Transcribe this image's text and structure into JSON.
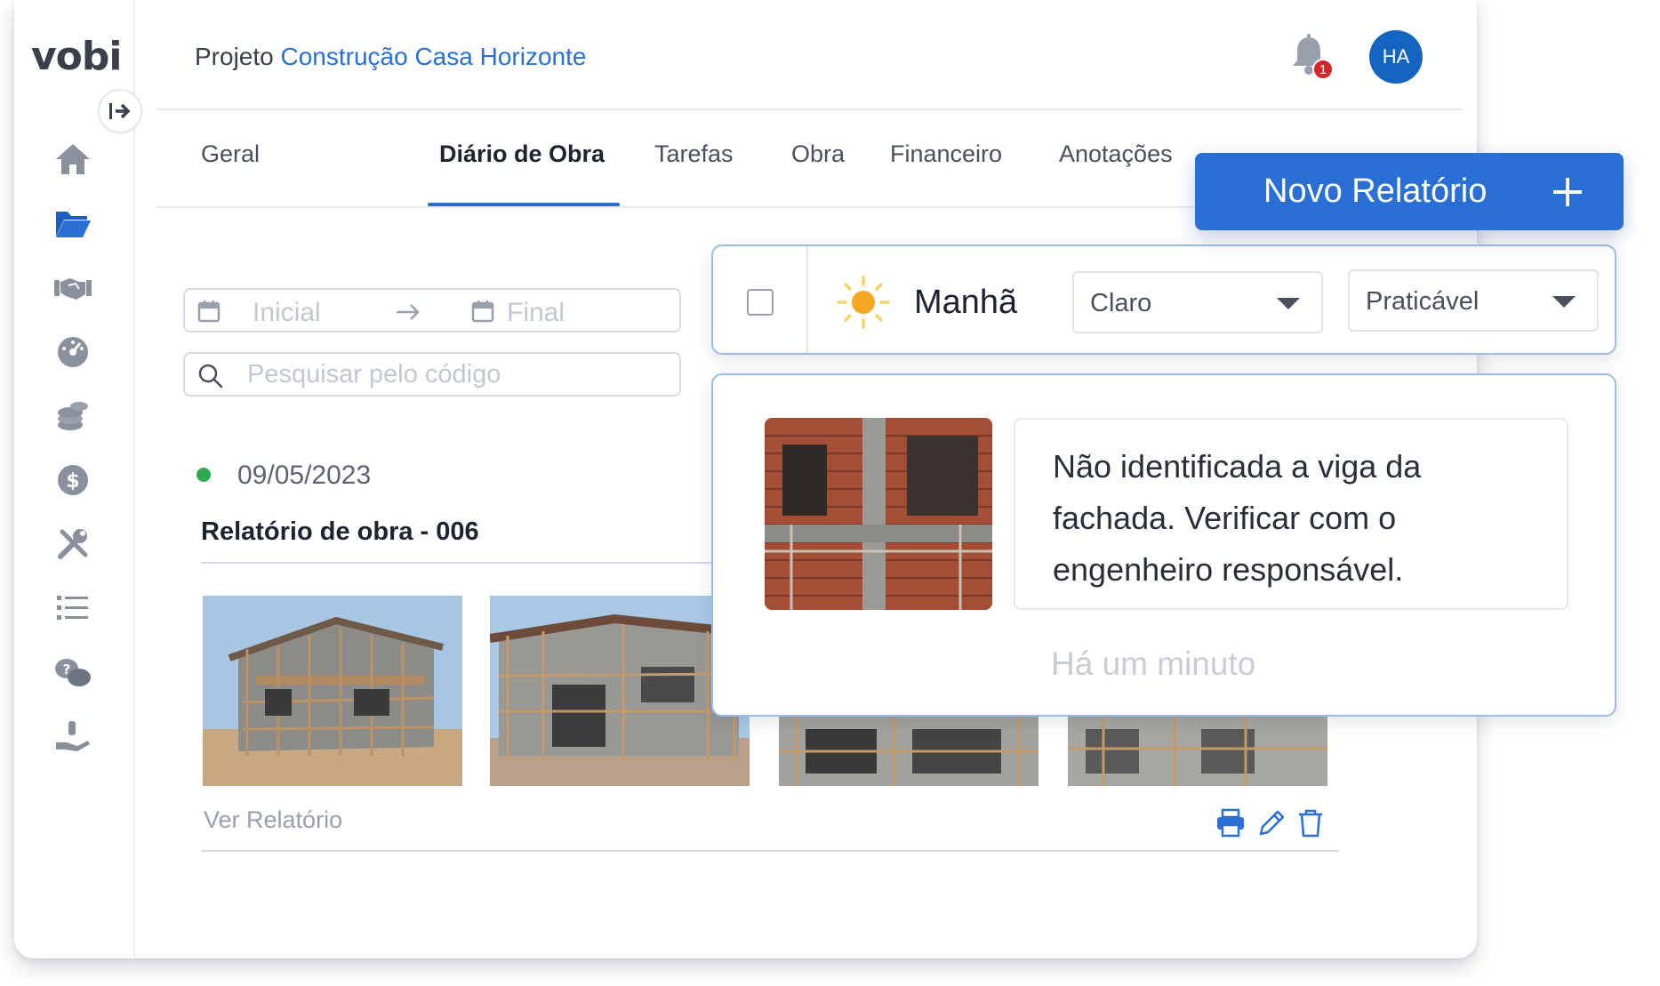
{
  "app": {
    "logo": "vobi"
  },
  "header": {
    "project_prefix": "Projeto",
    "project_name": "Construção Casa Horizonte",
    "notification_count": "1",
    "avatar_initials": "HA"
  },
  "tabs": [
    {
      "label": "Geral"
    },
    {
      "label": "Diário de Obra",
      "active": true
    },
    {
      "label": "Tarefas"
    },
    {
      "label": "Obra"
    },
    {
      "label": "Financeiro"
    },
    {
      "label": "Anotações"
    }
  ],
  "sidebar": {
    "icons": [
      "home-icon",
      "folder-icon",
      "handshake-icon",
      "dashboard-icon",
      "coins-icon",
      "dollar-icon",
      "tools-icon",
      "list-icon",
      "chat-help-icon",
      "hand-money-icon"
    ]
  },
  "filters": {
    "date_start_placeholder": "Inicial",
    "date_end_placeholder": "Final",
    "search_placeholder": "Pesquisar pelo código"
  },
  "report": {
    "date": "09/05/2023",
    "title": "Relatório de obra - 006",
    "view_link": "Ver Relatório",
    "status_color": "#2fa84f"
  },
  "new_report_button": {
    "label": "Novo Relatório"
  },
  "weather": {
    "period": "Manhã",
    "condition": "Claro",
    "practicability": "Praticável"
  },
  "note": {
    "text": "Não identificada a viga da fachada. Verificar com o engenheiro responsável.",
    "time": "Há um minuto"
  },
  "colors": {
    "accent": "#2a6fd6",
    "badge": "#d6262c",
    "avatar": "#1565c0"
  }
}
